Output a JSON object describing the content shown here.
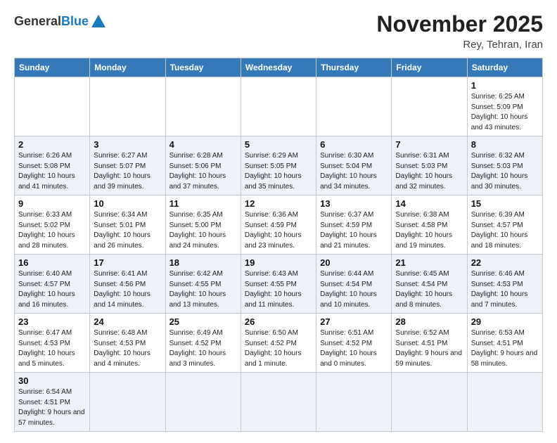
{
  "header": {
    "logo_general": "General",
    "logo_blue": "Blue",
    "title": "November 2025",
    "location": "Rey, Tehran, Iran"
  },
  "weekdays": [
    "Sunday",
    "Monday",
    "Tuesday",
    "Wednesday",
    "Thursday",
    "Friday",
    "Saturday"
  ],
  "weeks": [
    [
      {
        "day": "",
        "info": ""
      },
      {
        "day": "",
        "info": ""
      },
      {
        "day": "",
        "info": ""
      },
      {
        "day": "",
        "info": ""
      },
      {
        "day": "",
        "info": ""
      },
      {
        "day": "",
        "info": ""
      },
      {
        "day": "1",
        "info": "Sunrise: 6:25 AM\nSunset: 5:09 PM\nDaylight: 10 hours\nand 43 minutes."
      }
    ],
    [
      {
        "day": "2",
        "info": "Sunrise: 6:26 AM\nSunset: 5:08 PM\nDaylight: 10 hours\nand 41 minutes."
      },
      {
        "day": "3",
        "info": "Sunrise: 6:27 AM\nSunset: 5:07 PM\nDaylight: 10 hours\nand 39 minutes."
      },
      {
        "day": "4",
        "info": "Sunrise: 6:28 AM\nSunset: 5:06 PM\nDaylight: 10 hours\nand 37 minutes."
      },
      {
        "day": "5",
        "info": "Sunrise: 6:29 AM\nSunset: 5:05 PM\nDaylight: 10 hours\nand 35 minutes."
      },
      {
        "day": "6",
        "info": "Sunrise: 6:30 AM\nSunset: 5:04 PM\nDaylight: 10 hours\nand 34 minutes."
      },
      {
        "day": "7",
        "info": "Sunrise: 6:31 AM\nSunset: 5:03 PM\nDaylight: 10 hours\nand 32 minutes."
      },
      {
        "day": "8",
        "info": "Sunrise: 6:32 AM\nSunset: 5:03 PM\nDaylight: 10 hours\nand 30 minutes."
      }
    ],
    [
      {
        "day": "9",
        "info": "Sunrise: 6:33 AM\nSunset: 5:02 PM\nDaylight: 10 hours\nand 28 minutes."
      },
      {
        "day": "10",
        "info": "Sunrise: 6:34 AM\nSunset: 5:01 PM\nDaylight: 10 hours\nand 26 minutes."
      },
      {
        "day": "11",
        "info": "Sunrise: 6:35 AM\nSunset: 5:00 PM\nDaylight: 10 hours\nand 24 minutes."
      },
      {
        "day": "12",
        "info": "Sunrise: 6:36 AM\nSunset: 4:59 PM\nDaylight: 10 hours\nand 23 minutes."
      },
      {
        "day": "13",
        "info": "Sunrise: 6:37 AM\nSunset: 4:59 PM\nDaylight: 10 hours\nand 21 minutes."
      },
      {
        "day": "14",
        "info": "Sunrise: 6:38 AM\nSunset: 4:58 PM\nDaylight: 10 hours\nand 19 minutes."
      },
      {
        "day": "15",
        "info": "Sunrise: 6:39 AM\nSunset: 4:57 PM\nDaylight: 10 hours\nand 18 minutes."
      }
    ],
    [
      {
        "day": "16",
        "info": "Sunrise: 6:40 AM\nSunset: 4:57 PM\nDaylight: 10 hours\nand 16 minutes."
      },
      {
        "day": "17",
        "info": "Sunrise: 6:41 AM\nSunset: 4:56 PM\nDaylight: 10 hours\nand 14 minutes."
      },
      {
        "day": "18",
        "info": "Sunrise: 6:42 AM\nSunset: 4:55 PM\nDaylight: 10 hours\nand 13 minutes."
      },
      {
        "day": "19",
        "info": "Sunrise: 6:43 AM\nSunset: 4:55 PM\nDaylight: 10 hours\nand 11 minutes."
      },
      {
        "day": "20",
        "info": "Sunrise: 6:44 AM\nSunset: 4:54 PM\nDaylight: 10 hours\nand 10 minutes."
      },
      {
        "day": "21",
        "info": "Sunrise: 6:45 AM\nSunset: 4:54 PM\nDaylight: 10 hours\nand 8 minutes."
      },
      {
        "day": "22",
        "info": "Sunrise: 6:46 AM\nSunset: 4:53 PM\nDaylight: 10 hours\nand 7 minutes."
      }
    ],
    [
      {
        "day": "23",
        "info": "Sunrise: 6:47 AM\nSunset: 4:53 PM\nDaylight: 10 hours\nand 5 minutes."
      },
      {
        "day": "24",
        "info": "Sunrise: 6:48 AM\nSunset: 4:53 PM\nDaylight: 10 hours\nand 4 minutes."
      },
      {
        "day": "25",
        "info": "Sunrise: 6:49 AM\nSunset: 4:52 PM\nDaylight: 10 hours\nand 3 minutes."
      },
      {
        "day": "26",
        "info": "Sunrise: 6:50 AM\nSunset: 4:52 PM\nDaylight: 10 hours\nand 1 minute."
      },
      {
        "day": "27",
        "info": "Sunrise: 6:51 AM\nSunset: 4:52 PM\nDaylight: 10 hours\nand 0 minutes."
      },
      {
        "day": "28",
        "info": "Sunrise: 6:52 AM\nSunset: 4:51 PM\nDaylight: 9 hours\nand 59 minutes."
      },
      {
        "day": "29",
        "info": "Sunrise: 6:53 AM\nSunset: 4:51 PM\nDaylight: 9 hours\nand 58 minutes."
      }
    ],
    [
      {
        "day": "30",
        "info": "Sunrise: 6:54 AM\nSunset: 4:51 PM\nDaylight: 9 hours\nand 57 minutes."
      },
      {
        "day": "",
        "info": ""
      },
      {
        "day": "",
        "info": ""
      },
      {
        "day": "",
        "info": ""
      },
      {
        "day": "",
        "info": ""
      },
      {
        "day": "",
        "info": ""
      },
      {
        "day": "",
        "info": ""
      }
    ]
  ]
}
